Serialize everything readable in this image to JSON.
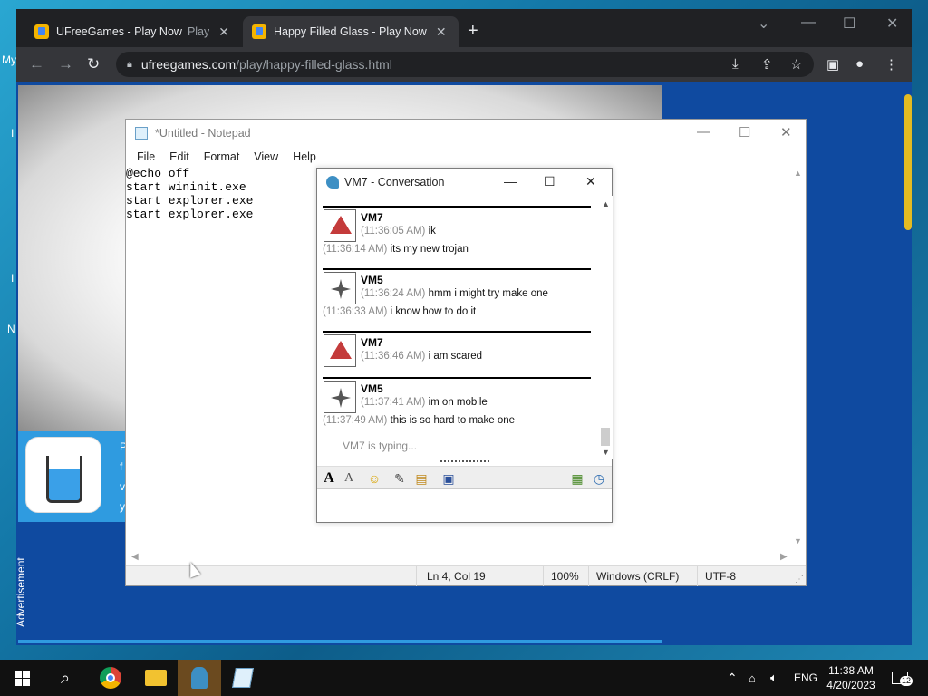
{
  "desktop": {
    "edge_labels": [
      "My",
      "I",
      "I",
      "N"
    ]
  },
  "chrome": {
    "tabs": [
      {
        "title": "UFreeGames - Play Now",
        "suffix": "Play",
        "active": false
      },
      {
        "title": "Happy Filled Glass - Play Now",
        "suffix": "",
        "active": true
      }
    ],
    "new_tab": "+",
    "window_controls": {
      "minimize": "—",
      "maximize": "☐",
      "close": "✕",
      "dropdown": "⌄"
    },
    "address": {
      "host": "ufreegames.com",
      "path": "/play/happy-filled-glass.html"
    },
    "nav": {
      "back": "←",
      "forward": "→",
      "reload": "↻"
    },
    "ad_label": "Advertisement",
    "ad_text_lines": [
      "P",
      "f",
      "v",
      "y"
    ]
  },
  "notepad": {
    "title": "*Untitled - Notepad",
    "menu": [
      "File",
      "Edit",
      "Format",
      "View",
      "Help"
    ],
    "lines": [
      "@echo off",
      "start wininit.exe",
      "start explorer.exe",
      "start explorer.exe"
    ],
    "status": {
      "position": "Ln 4, Col 19",
      "zoom": "100%",
      "line_ending": "Windows (CRLF)",
      "encoding": "UTF-8"
    }
  },
  "conversation": {
    "title": "VM7 - Conversation",
    "messages": [
      {
        "sender": "VM7",
        "avatar": "vm7",
        "lines": [
          {
            "ts": "(11:36:05 AM)",
            "text": "ik"
          },
          {
            "ts": "(11:36:14 AM)",
            "text": "its my new trojan"
          }
        ]
      },
      {
        "sender": "VM5",
        "avatar": "vm5",
        "lines": [
          {
            "ts": "(11:36:24 AM)",
            "text": "hmm i might try make one"
          },
          {
            "ts": "(11:36:33 AM)",
            "text": "i know how to do it"
          }
        ]
      },
      {
        "sender": "VM7",
        "avatar": "vm7",
        "lines": [
          {
            "ts": "(11:36:46 AM)",
            "text": "i am scared"
          }
        ]
      },
      {
        "sender": "VM5",
        "avatar": "vm5",
        "lines": [
          {
            "ts": "(11:37:41 AM)",
            "text": "im on mobile"
          },
          {
            "ts": "(11:37:49 AM)",
            "text": "this is so hard to make one"
          }
        ]
      }
    ],
    "typing": "VM7 is typing...",
    "toolbar_icons": [
      "font-icon",
      "font-style-icon",
      "smiley-icon",
      "attach-icon",
      "file-icon",
      "save-icon",
      "history-icon",
      "clock-icon"
    ]
  },
  "taskbar": {
    "apps": [
      "start",
      "search",
      "chrome",
      "explorer",
      "im-client",
      "notepad"
    ],
    "tray": {
      "lang": "ENG",
      "time": "11:38 AM",
      "date": "4/20/2023",
      "notifications": "12"
    }
  }
}
